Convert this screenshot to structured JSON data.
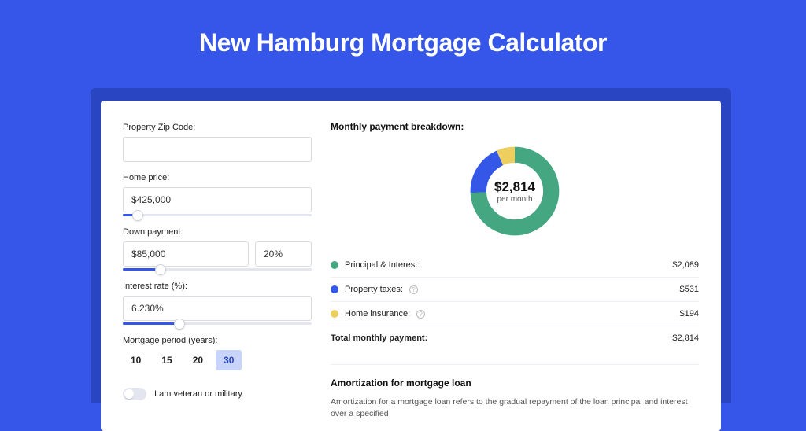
{
  "page_title": "New Hamburg Mortgage Calculator",
  "colors": {
    "principal_interest": "#44a781",
    "property_taxes": "#3457e8",
    "home_insurance": "#eccf5e"
  },
  "form": {
    "zip_label": "Property Zip Code:",
    "zip_value": "",
    "home_price_label": "Home price:",
    "home_price_value": "$425,000",
    "home_price_slider_pct": 8,
    "down_payment_label": "Down payment:",
    "down_payment_value": "$85,000",
    "down_payment_pct_value": "20%",
    "down_payment_slider_pct": 20,
    "interest_label": "Interest rate (%):",
    "interest_value": "6.230%",
    "interest_slider_pct": 30,
    "period_label": "Mortgage period (years):",
    "periods": [
      "10",
      "15",
      "20",
      "30"
    ],
    "period_selected": "30",
    "veteran_label": "I am veteran or military",
    "veteran_on": false
  },
  "breakdown": {
    "title": "Monthly payment breakdown:",
    "center_amount": "$2,814",
    "center_sub": "per month",
    "items": [
      {
        "label": "Principal & Interest:",
        "value": "$2,089",
        "color_key": "principal_interest",
        "has_info": false
      },
      {
        "label": "Property taxes:",
        "value": "$531",
        "color_key": "property_taxes",
        "has_info": true
      },
      {
        "label": "Home insurance:",
        "value": "$194",
        "color_key": "home_insurance",
        "has_info": true
      }
    ],
    "total_label": "Total monthly payment:",
    "total_value": "$2,814"
  },
  "chart_data": {
    "type": "pie",
    "title": "Monthly payment breakdown",
    "series": [
      {
        "name": "Principal & Interest",
        "value": 2089
      },
      {
        "name": "Property taxes",
        "value": 531
      },
      {
        "name": "Home insurance",
        "value": 194
      }
    ],
    "total": 2814,
    "unit": "USD/month"
  },
  "amort": {
    "title": "Amortization for mortgage loan",
    "text": "Amortization for a mortgage loan refers to the gradual repayment of the loan principal and interest over a specified"
  }
}
